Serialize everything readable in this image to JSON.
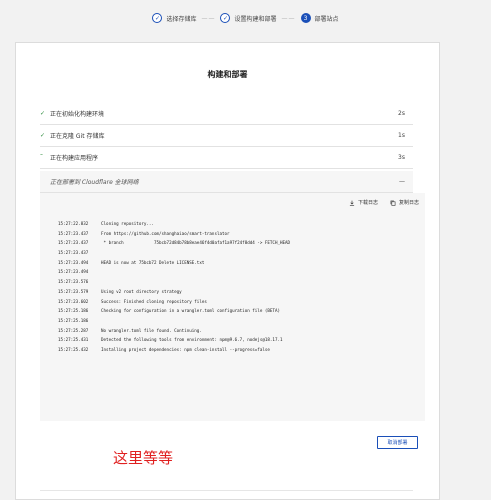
{
  "stepper": {
    "steps": [
      {
        "label": "选择存储库",
        "marker": "✓"
      },
      {
        "label": "设置构建和部署",
        "marker": "✓"
      },
      {
        "label": "部署站点",
        "marker": "3"
      }
    ],
    "separator": "——"
  },
  "card": {
    "title": "构建和部署",
    "stages": [
      {
        "icon": "✓",
        "label": "正在初始化构建环境",
        "duration": "2s"
      },
      {
        "icon": "✓",
        "label": "正在克隆 Git 存储库",
        "duration": "1s"
      },
      {
        "icon": "˜",
        "label": "正在构建应用程序",
        "duration": "3s"
      },
      {
        "icon": "",
        "label": "正在部署到 Cloudflare 全球网络",
        "duration": "—"
      }
    ]
  },
  "log": {
    "download_label": "下载日志",
    "copy_label": "复制日志",
    "lines": [
      {
        "time": "15:27:22.832",
        "text": "Cloning repository..."
      },
      {
        "time": "15:27:23.437",
        "text": "From https://github.com/shanghaiao/smart-translator"
      },
      {
        "time": "15:27:23.437",
        "text": " * branch            75bcb72d84b78b8eae46f4d0afaf1a97f24f8dd4 -> FETCH_HEAD"
      },
      {
        "time": "15:27:23.437",
        "text": ""
      },
      {
        "time": "15:27:23.494",
        "text": "HEAD is now at 75bcb72 Delete LICENSE.txt"
      },
      {
        "time": "15:27:23.494",
        "text": ""
      },
      {
        "time": "15:27:23.576",
        "text": ""
      },
      {
        "time": "15:27:23.579",
        "text": "Using v2 root directory strategy"
      },
      {
        "time": "15:27:23.602",
        "text": "Success: Finished cloning repository files"
      },
      {
        "time": "15:27:25.186",
        "text": "Checking for configuration in a wrangler.toml configuration file (BETA)"
      },
      {
        "time": "15:27:25.186",
        "text": ""
      },
      {
        "time": "15:27:25.287",
        "text": "No wrangler.toml file found. Continuing."
      },
      {
        "time": "15:27:25.431",
        "text": "Detected the following tools from environment: npm@9.6.7, nodejs@18.17.1"
      },
      {
        "time": "15:27:25.432",
        "text": "Installing project dependencies: npm clean-install --progress=false"
      }
    ]
  },
  "actions": {
    "cancel_label": "取消部署"
  },
  "annotation": "这里等等",
  "colors": {
    "accent": "#1a4fb8",
    "success": "#2a8a3a",
    "annotation": "#e02020"
  }
}
